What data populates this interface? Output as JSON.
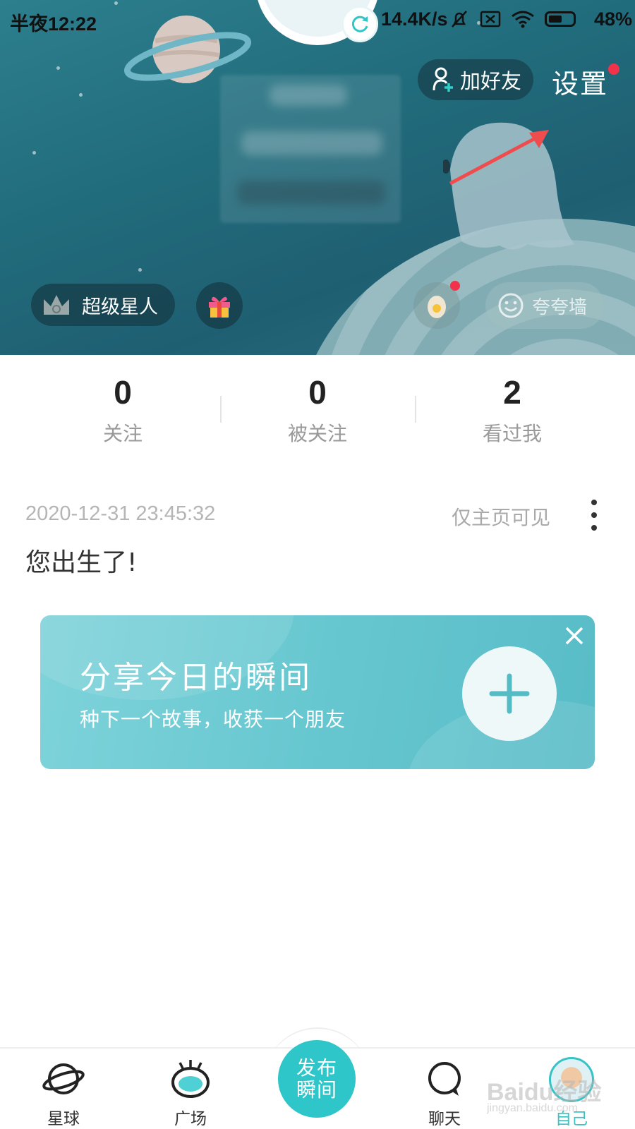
{
  "status_bar": {
    "time": "半夜12:22",
    "network_speed": "14.4K/s",
    "battery": "48%"
  },
  "header": {
    "add_friend_label": "加好友",
    "settings_label": "设置",
    "vip_label": "超级星人",
    "praise_wall_label": "夸夸墙"
  },
  "stats": [
    {
      "value": "0",
      "label": "关注"
    },
    {
      "value": "0",
      "label": "被关注"
    },
    {
      "value": "2",
      "label": "看过我"
    }
  ],
  "post": {
    "date": "2020-12-31 23:45:32",
    "visibility": "仅主页可见",
    "text": "您出生了!"
  },
  "share_card": {
    "title": "分享今日的瞬间",
    "subtitle": "种下一个故事，收获一个朋友"
  },
  "tabbar": {
    "tabs": [
      {
        "label": "星球",
        "icon": "planet-icon"
      },
      {
        "label": "广场",
        "icon": "eye-icon"
      },
      {
        "label": "聊天",
        "icon": "chat-icon"
      },
      {
        "label": "自己",
        "icon": "avatar"
      }
    ],
    "publish_line1": "发布",
    "publish_line2": "瞬间",
    "active_color": "#37c3c6"
  },
  "watermark": {
    "text": "Baidu经验",
    "url": "jingyan.baidu.com"
  },
  "colors": {
    "accent": "#2fc6c9",
    "badge_red": "#f0334a",
    "header_bg": "#216c7c"
  }
}
